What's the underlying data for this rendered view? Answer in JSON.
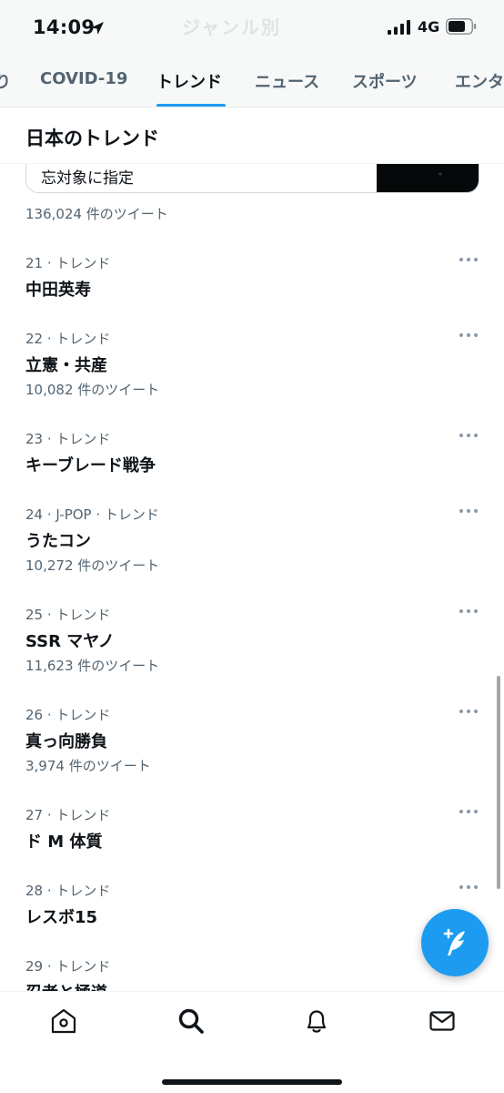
{
  "status_bar": {
    "time": "14:09",
    "network": "4G",
    "faded_title": "ジャンル別"
  },
  "tabs": [
    {
      "label": "り",
      "active": false
    },
    {
      "label": "COVID-19",
      "active": false
    },
    {
      "label": "トレンド",
      "active": true
    },
    {
      "label": "ニュース",
      "active": false
    },
    {
      "label": "スポーツ",
      "active": false
    },
    {
      "label": "エンタ",
      "active": false
    }
  ],
  "section": {
    "title": "日本のトレンド"
  },
  "news_card": {
    "text": "忘対象に指定"
  },
  "top_count": "136,024 件のツイート",
  "trends": [
    {
      "meta": "21 · トレンド",
      "name": "中田英寿",
      "count": ""
    },
    {
      "meta": "22 · トレンド",
      "name": "立憲・共産",
      "count": "10,082 件のツイート"
    },
    {
      "meta": "23 · トレンド",
      "name": "キーブレード戦争",
      "count": ""
    },
    {
      "meta": "24 · J-POP · トレンド",
      "name": "うたコン",
      "count": "10,272 件のツイート"
    },
    {
      "meta": "25 · トレンド",
      "name": "SSR マヤノ",
      "count": "11,623 件のツイート"
    },
    {
      "meta": "26 · トレンド",
      "name": "真っ向勝負",
      "count": "3,974 件のツイート"
    },
    {
      "meta": "27 · トレンド",
      "name": "ド M 体質",
      "count": ""
    },
    {
      "meta": "28 · トレンド",
      "name": "レスボ15",
      "count": ""
    },
    {
      "meta": "29 · トレンド",
      "name": "忍者と極道",
      "count": ""
    }
  ],
  "bottom_nav": [
    {
      "name": "home-icon",
      "active": false
    },
    {
      "name": "search-icon",
      "active": true
    },
    {
      "name": "notifications-icon",
      "active": false
    },
    {
      "name": "messages-icon",
      "active": false
    }
  ],
  "colors": {
    "accent": "#1d9bf0",
    "secondary_text": "#536471",
    "primary_text": "#0f1419"
  }
}
